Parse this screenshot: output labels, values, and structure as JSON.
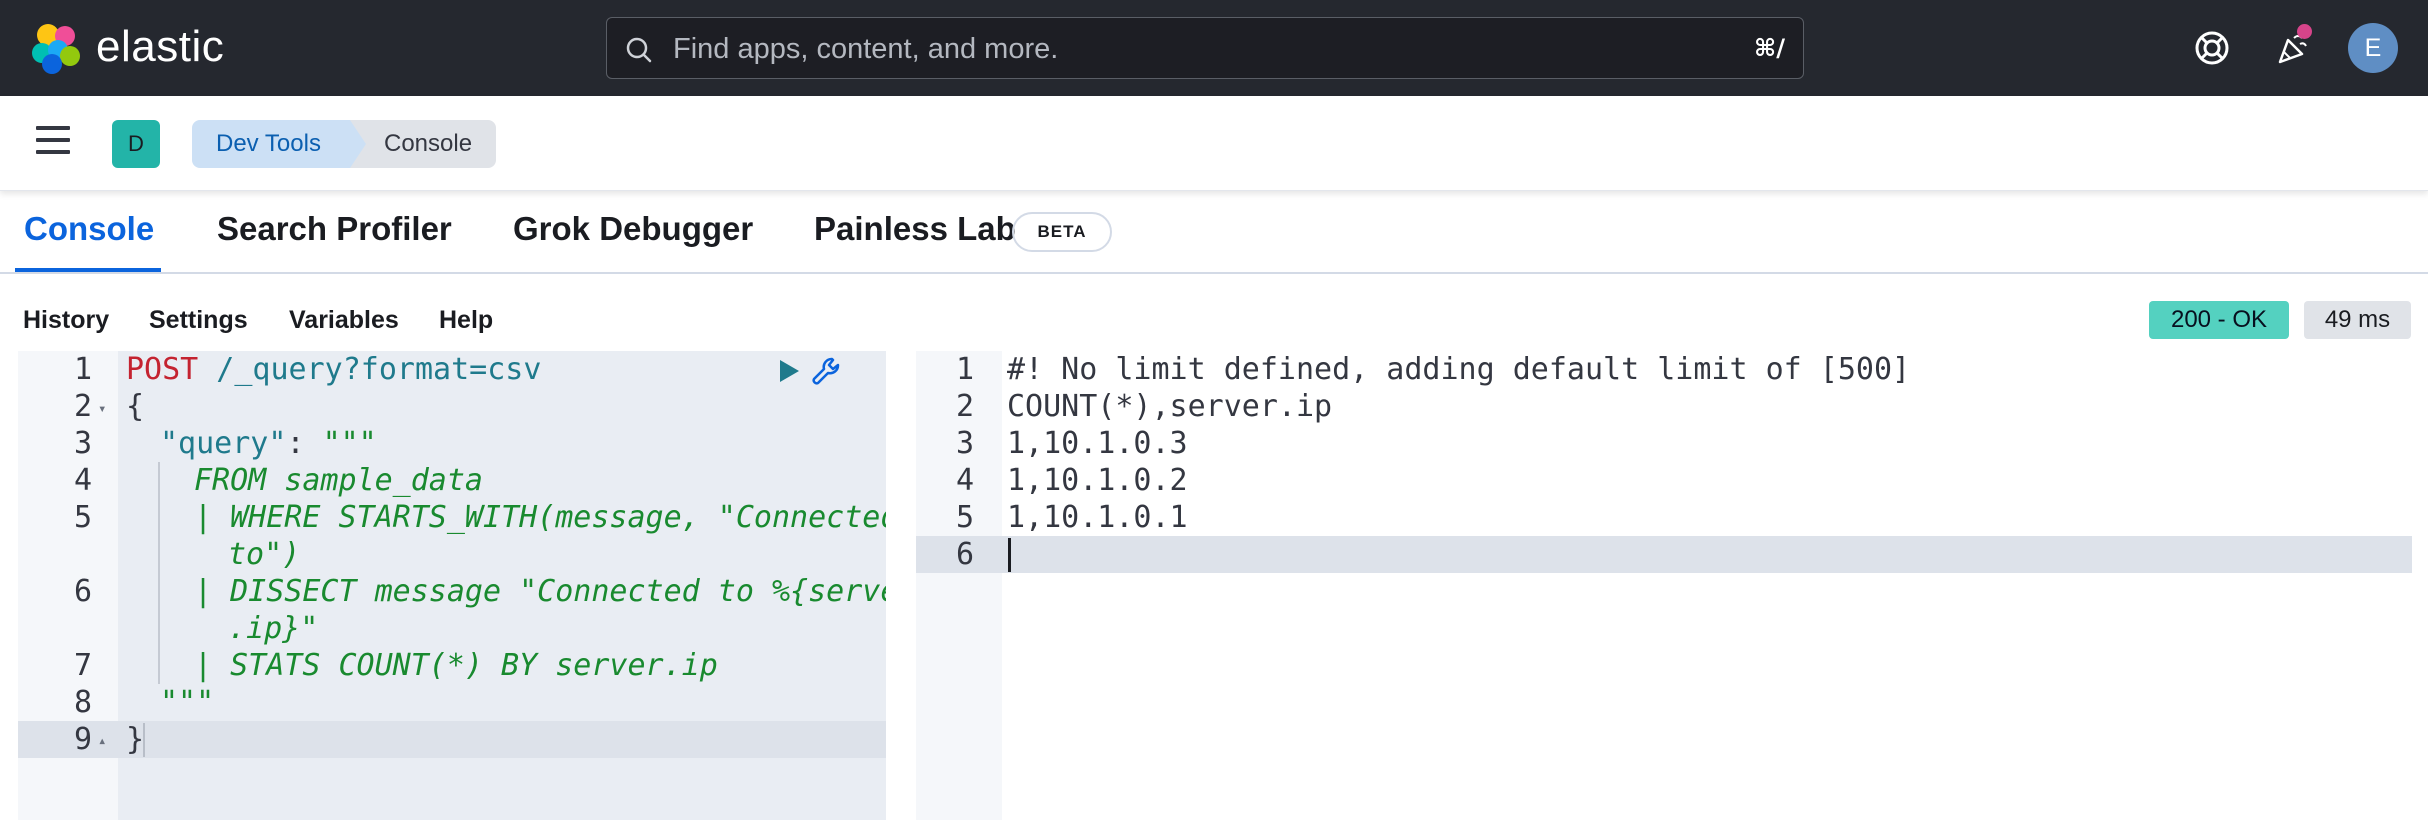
{
  "header": {
    "logo_text": "elastic",
    "search_placeholder": "Find apps, content, and more.",
    "search_shortcut": "⌘/",
    "help_icon": "lifebuoy-icon",
    "news_icon": "party-popper-icon",
    "user_initial": "E"
  },
  "breadcrumb": {
    "space_initial": "D",
    "items": [
      "Dev Tools",
      "Console"
    ]
  },
  "tabs": {
    "items": [
      "Console",
      "Search Profiler",
      "Grok Debugger",
      "Painless Lab"
    ],
    "active": "Console",
    "beta_badge": "BETA"
  },
  "toolbar": {
    "items": [
      "History",
      "Settings",
      "Variables",
      "Help"
    ],
    "status": "200 - OK",
    "duration": "49 ms",
    "status_color": "#54d1c0"
  },
  "request_editor": {
    "line_numbers": [
      "1",
      "2",
      "3",
      "4",
      "5",
      "",
      "6",
      "",
      "7",
      "8",
      "9"
    ],
    "lines": [
      {
        "method": "POST",
        "url": " /_query?format=csv"
      },
      {
        "text": "{"
      },
      {
        "key": "\"query\"",
        "colon": ": ",
        "val": "\"\"\""
      },
      {
        "text": "FROM sample_data"
      },
      {
        "text": "| WHERE STARTS_WITH(message, \"Connected"
      },
      {
        "text": "to\")"
      },
      {
        "text": "| DISSECT message \"Connected to %{server"
      },
      {
        "text": ".ip}\""
      },
      {
        "text": "| STATS COUNT(*) BY server.ip"
      },
      {
        "text": "\"\"\""
      },
      {
        "text": "}"
      }
    ],
    "run_icon": "play-icon",
    "actions_icon": "wrench-icon"
  },
  "response_editor": {
    "line_numbers": [
      "1",
      "2",
      "3",
      "4",
      "5",
      "6"
    ],
    "lines": [
      "#! No limit defined, adding default limit of [500]",
      "COUNT(*),server.ip",
      "1,10.1.0.3",
      "1,10.1.0.2",
      "1,10.1.0.1",
      ""
    ]
  }
}
